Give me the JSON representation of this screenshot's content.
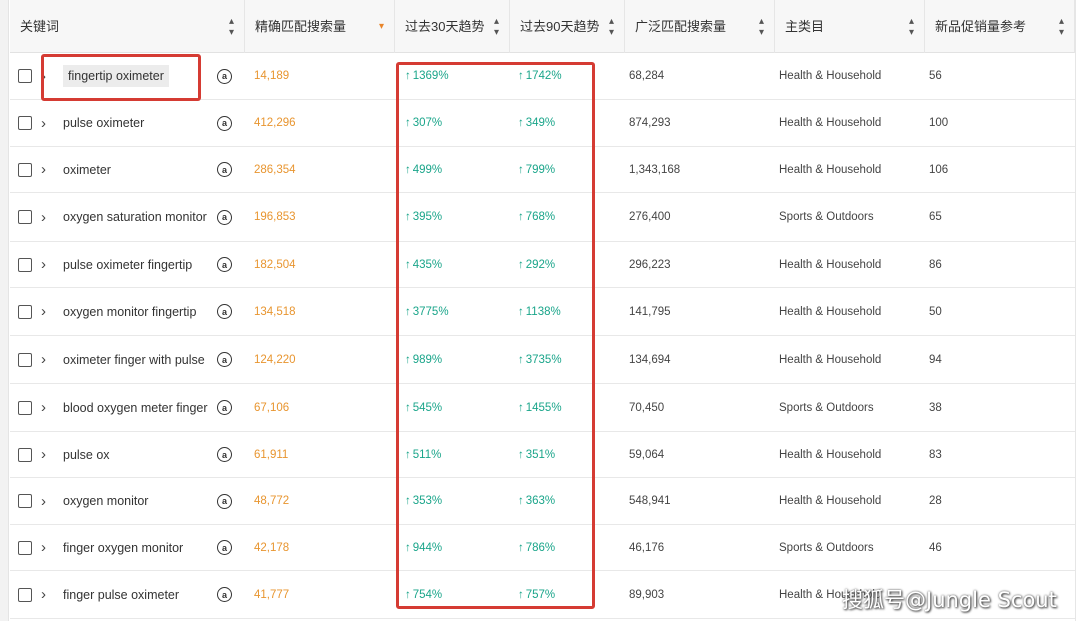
{
  "columns": [
    {
      "label": "关键词"
    },
    {
      "label": "精确匹配搜索量"
    },
    {
      "label": "过去30天趋势"
    },
    {
      "label": "过去90天趋势"
    },
    {
      "label": "广泛匹配搜索量"
    },
    {
      "label": "主类目"
    },
    {
      "label": "新品促销量参考"
    }
  ],
  "rows": [
    {
      "keyword": "fingertip oximeter",
      "exact": "14,189",
      "t30": "1369%",
      "t90": "1742%",
      "broad": "68,284",
      "category": "Health & Household",
      "promo": "56"
    },
    {
      "keyword": "pulse oximeter",
      "exact": "412,296",
      "t30": "307%",
      "t90": "349%",
      "broad": "874,293",
      "category": "Health & Household",
      "promo": "100"
    },
    {
      "keyword": "oximeter",
      "exact": "286,354",
      "t30": "499%",
      "t90": "799%",
      "broad": "1,343,168",
      "category": "Health & Household",
      "promo": "106"
    },
    {
      "keyword": "oxygen saturation monitor",
      "exact": "196,853",
      "t30": "395%",
      "t90": "768%",
      "broad": "276,400",
      "category": "Sports & Outdoors",
      "promo": "65"
    },
    {
      "keyword": "pulse oximeter fingertip",
      "exact": "182,504",
      "t30": "435%",
      "t90": "292%",
      "broad": "296,223",
      "category": "Health & Household",
      "promo": "86"
    },
    {
      "keyword": "oxygen monitor fingertip",
      "exact": "134,518",
      "t30": "3775%",
      "t90": "1138%",
      "broad": "141,795",
      "category": "Health & Household",
      "promo": "50"
    },
    {
      "keyword": "oximeter finger with pulse",
      "exact": "124,220",
      "t30": "989%",
      "t90": "3735%",
      "broad": "134,694",
      "category": "Health & Household",
      "promo": "94"
    },
    {
      "keyword": "blood oxygen meter finger",
      "exact": "67,106",
      "t30": "545%",
      "t90": "1455%",
      "broad": "70,450",
      "category": "Sports & Outdoors",
      "promo": "38"
    },
    {
      "keyword": "pulse ox",
      "exact": "61,911",
      "t30": "511%",
      "t90": "351%",
      "broad": "59,064",
      "category": "Health & Household",
      "promo": "83"
    },
    {
      "keyword": "oxygen monitor",
      "exact": "48,772",
      "t30": "353%",
      "t90": "363%",
      "broad": "548,941",
      "category": "Health & Household",
      "promo": "28"
    },
    {
      "keyword": "finger oxygen monitor",
      "exact": "42,178",
      "t30": "944%",
      "t90": "786%",
      "broad": "46,176",
      "category": "Sports & Outdoors",
      "promo": "46"
    },
    {
      "keyword": "finger pulse oximeter",
      "exact": "41,777",
      "t30": "754%",
      "t90": "757%",
      "broad": "89,903",
      "category": "Health & Household",
      "promo": ""
    }
  ],
  "icons": {
    "row_icon": "amazon-icon",
    "trend_icon": "arrow-up-icon",
    "expand_icon": "chevron-right-icon",
    "sort_icon": "sort-icon"
  },
  "colors": {
    "exact_search": "#e8952f",
    "trend_up": "#1aa58a",
    "highlight_box": "#d53b33"
  },
  "watermark": "搜狐号@Jungle Scout"
}
